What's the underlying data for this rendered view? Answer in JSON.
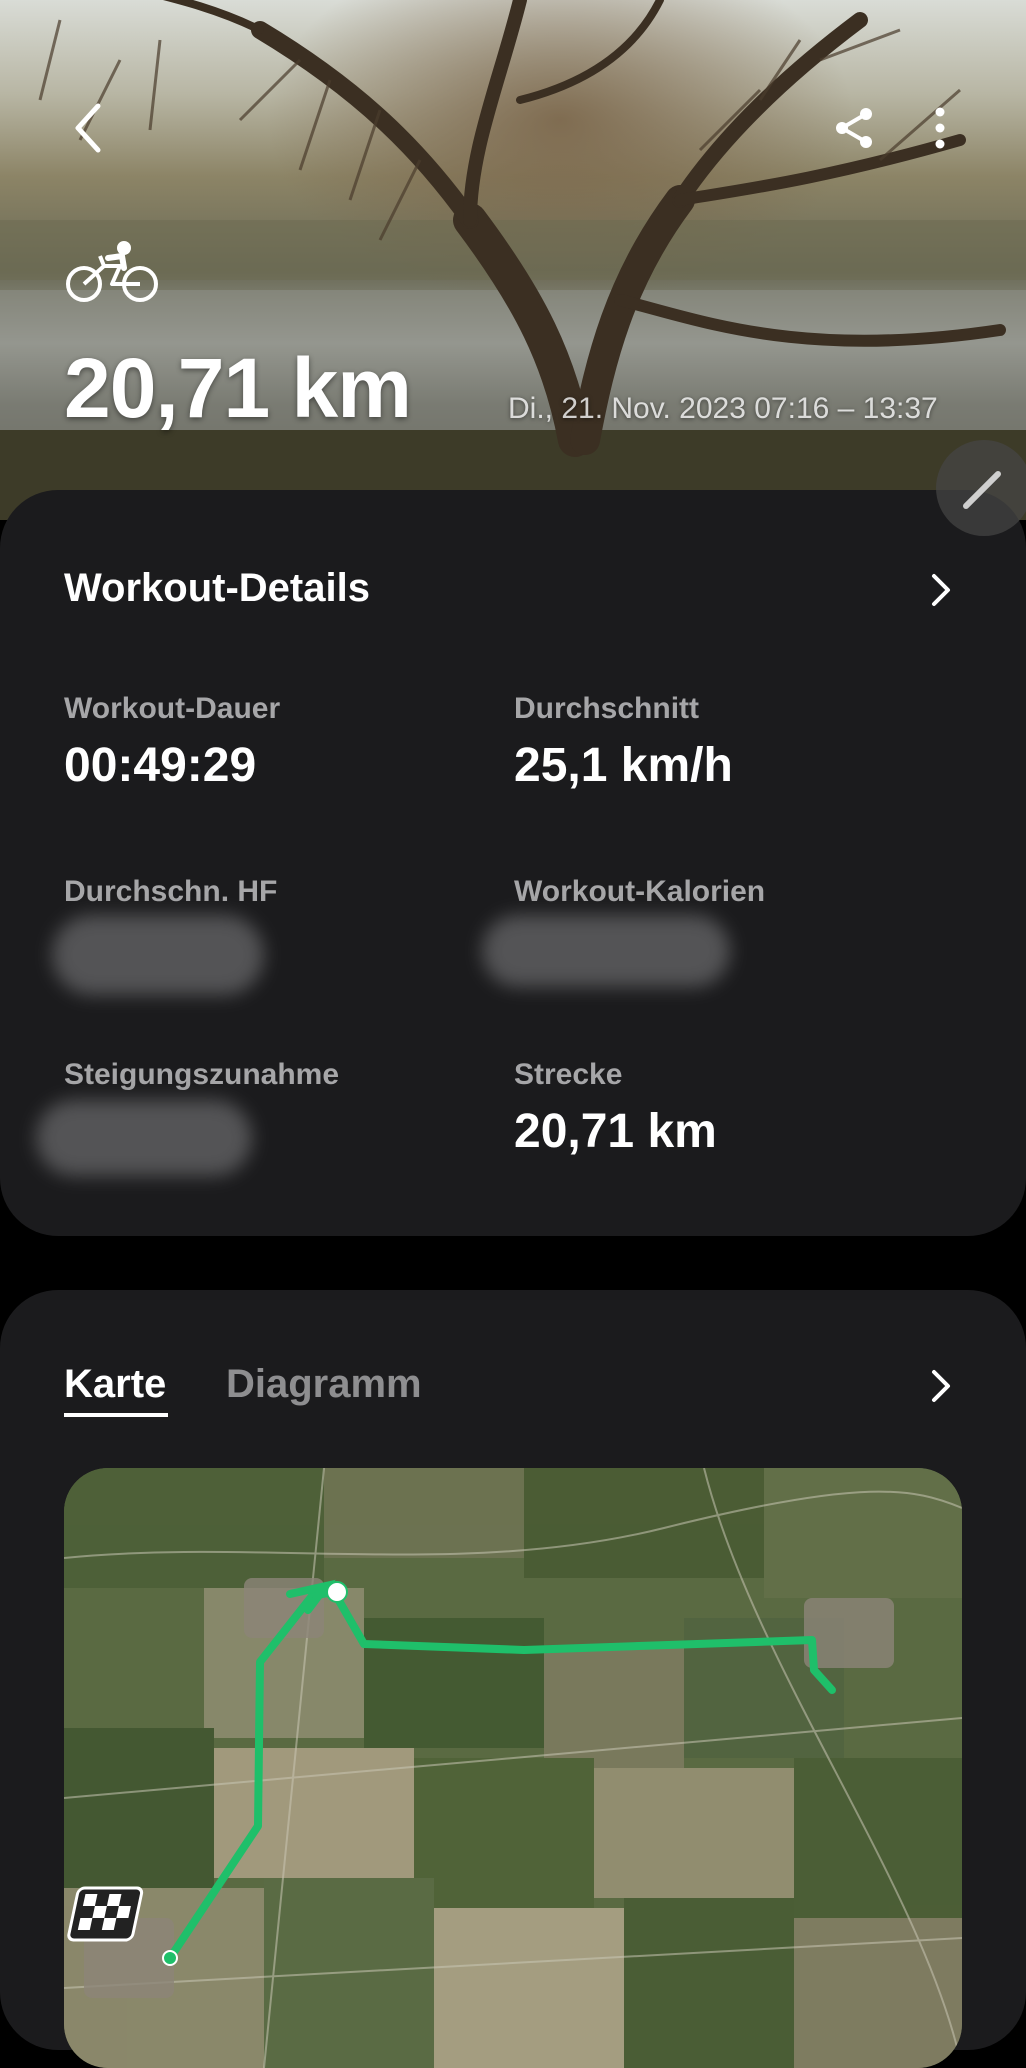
{
  "hero": {
    "distance": "20,71 km",
    "datetime": "Di., 21. Nov. 2023 07:16 – 13:37",
    "activity_icon": "cycling-icon"
  },
  "toolbar": {
    "back_icon": "chevron-left-icon",
    "share_icon": "share-icon",
    "more_icon": "more-vertical-icon",
    "edit_icon": "pencil-icon"
  },
  "details": {
    "title": "Workout-Details",
    "stats": [
      {
        "label": "Workout-Dauer",
        "value": "00:49:29"
      },
      {
        "label": "Durchschnitt",
        "value": "25,1 km/h"
      },
      {
        "label": "Durchschn. HF",
        "value": ""
      },
      {
        "label": "Workout-Kalorien",
        "value": ""
      },
      {
        "label": "Steigungszunahme",
        "value": ""
      },
      {
        "label": "Strecke",
        "value": "20,71 km"
      }
    ]
  },
  "map_card": {
    "tabs": [
      {
        "label": "Karte",
        "active": true
      },
      {
        "label": "Diagramm",
        "active": false
      }
    ]
  },
  "colors": {
    "route": "#1fbf6a",
    "card_bg": "#1b1b1d",
    "label": "#a6a6a8"
  }
}
